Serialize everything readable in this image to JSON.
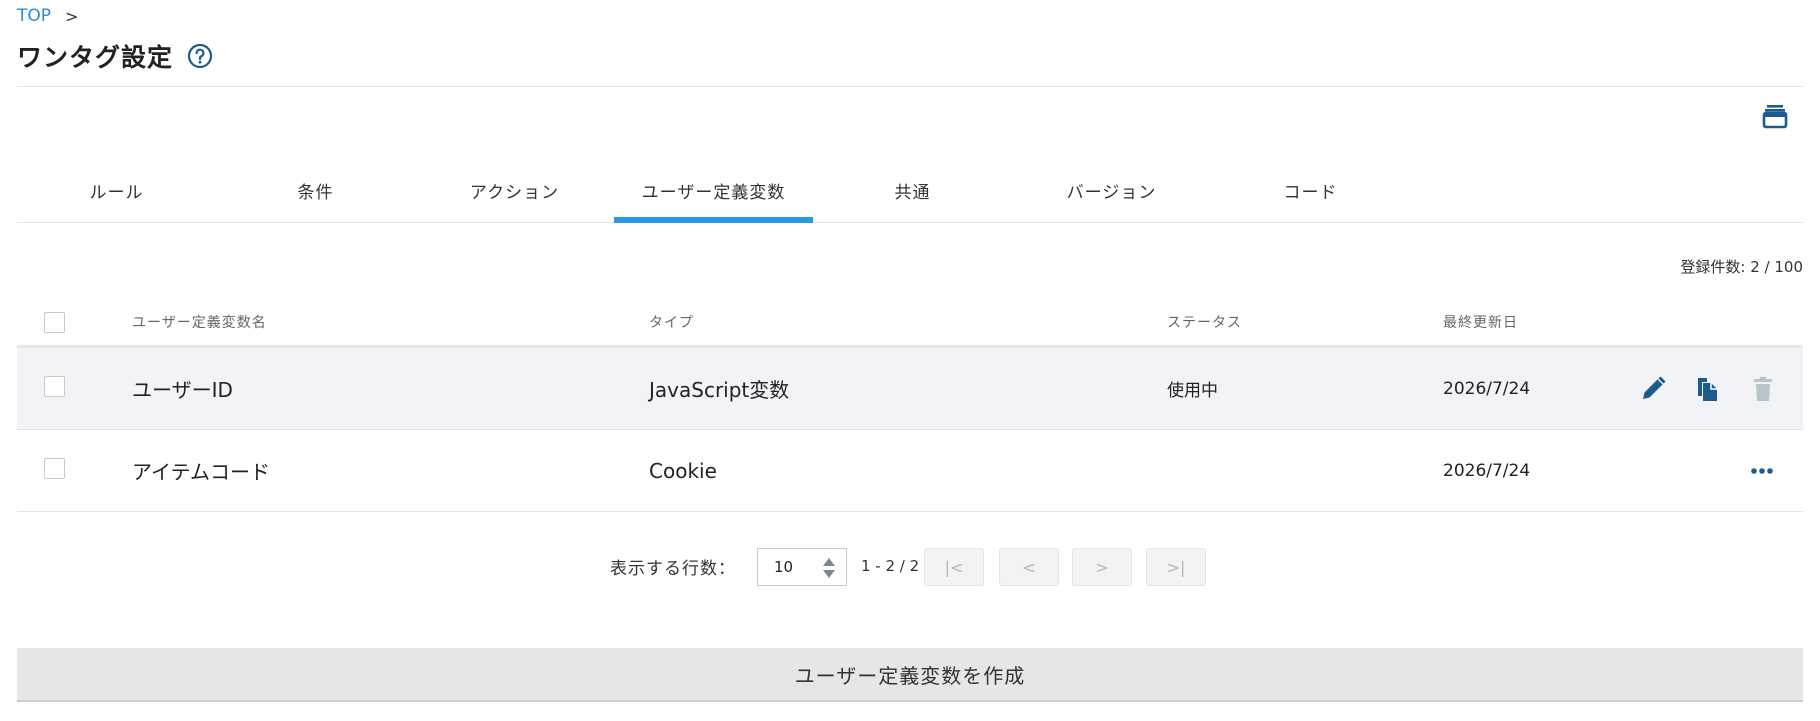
{
  "breadcrumb": {
    "top": "TOP",
    "separator": ">"
  },
  "page": {
    "title": "ワンタグ設定"
  },
  "tabs": [
    {
      "label": "ルール"
    },
    {
      "label": "条件"
    },
    {
      "label": "アクション"
    },
    {
      "label": "ユーザー定義変数",
      "active": true
    },
    {
      "label": "共通"
    },
    {
      "label": "バージョン"
    },
    {
      "label": "コード"
    }
  ],
  "count_text": "登録件数: 2 / 100",
  "table": {
    "headers": {
      "name": "ユーザー定義変数名",
      "type": "タイプ",
      "status": "ステータス",
      "updated": "最終更新日"
    },
    "rows": [
      {
        "name": "ユーザーID",
        "type": "JavaScript変数",
        "status": "使用中",
        "updated": "2026/7/24",
        "actions": [
          "edit-icon",
          "copy-icon",
          "trash-icon"
        ]
      },
      {
        "name": "アイテムコード",
        "type": "Cookie",
        "status": "",
        "updated": "2026/7/24",
        "actions": [
          "more-icon"
        ]
      }
    ]
  },
  "pagination": {
    "rows_label": "表示する行数：",
    "rows_value": "10",
    "range": "1 - 2 / 2",
    "first": "|<",
    "prev": "<",
    "next": ">",
    "last": ">|"
  },
  "create_button": "ユーザー定義変数を作成",
  "colors": {
    "accent": "#2a9ae6",
    "link": "#2a8dd4",
    "icon": "#1d5b8f",
    "row_highlight": "#f1f3f6"
  }
}
